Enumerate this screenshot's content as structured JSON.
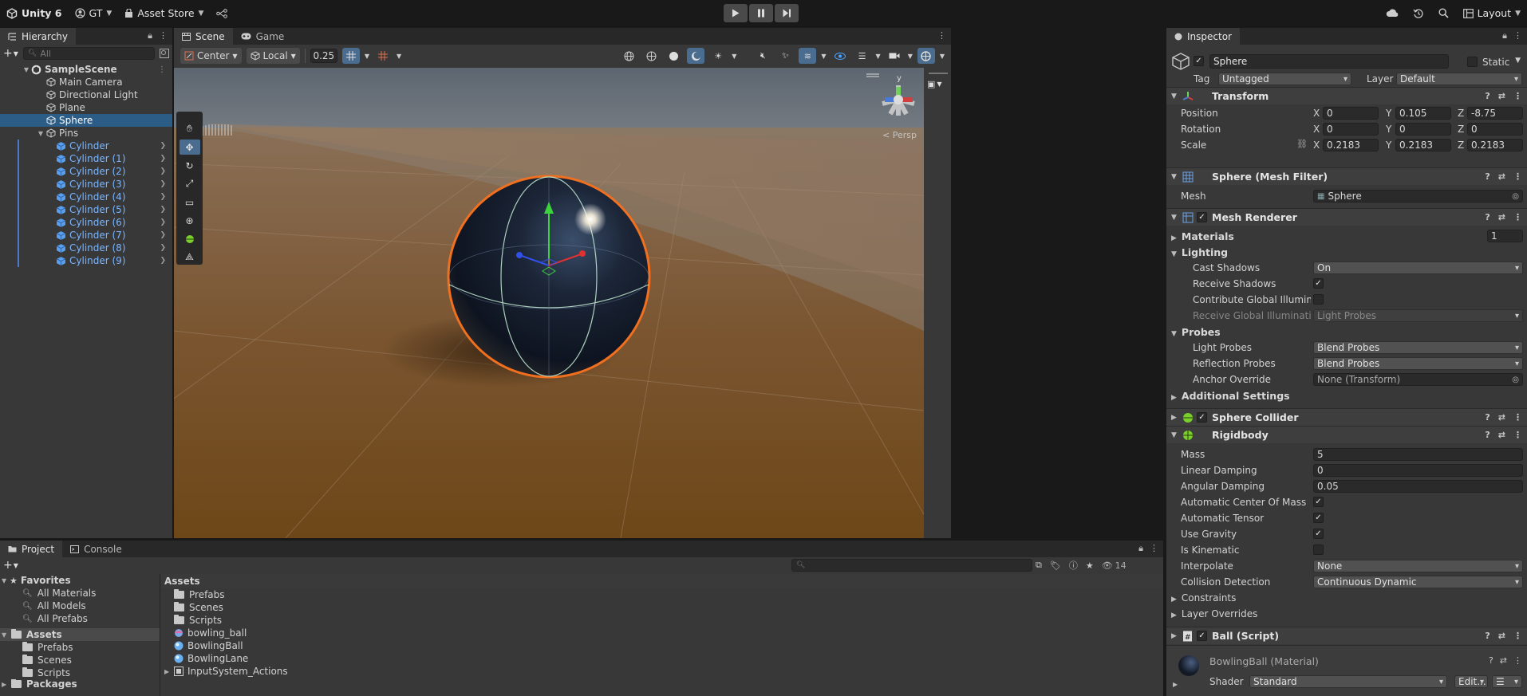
{
  "topbar": {
    "version": "Unity 6",
    "account": "GT",
    "asset_store": "Asset Store",
    "layout": "Layout"
  },
  "hierarchy": {
    "tab": "Hierarchy",
    "search_placeholder": "All",
    "scene": "SampleScene",
    "items": [
      "Main Camera",
      "Directional Light",
      "Plane",
      "Sphere",
      "Pins"
    ],
    "selected": "Sphere",
    "pins": [
      "Cylinder",
      "Cylinder (1)",
      "Cylinder (2)",
      "Cylinder (3)",
      "Cylinder (4)",
      "Cylinder (5)",
      "Cylinder (6)",
      "Cylinder (7)",
      "Cylinder (8)",
      "Cylinder (9)"
    ]
  },
  "scene_view": {
    "tabs": [
      "Scene",
      "Game"
    ],
    "pivot": "Center",
    "space": "Local",
    "snap": "0.25",
    "gizmo_label": "< Persp",
    "gizmo_axis": "y"
  },
  "inspector": {
    "tab": "Inspector",
    "object_name": "Sphere",
    "static_label": "Static",
    "tag_label": "Tag",
    "tag": "Untagged",
    "layer_label": "Layer",
    "layer": "Default",
    "transform": {
      "title": "Transform",
      "position_label": "Position",
      "rotation_label": "Rotation",
      "scale_label": "Scale",
      "position": {
        "x": "0",
        "y": "0.105",
        "z": "-8.75"
      },
      "rotation": {
        "x": "0",
        "y": "0",
        "z": "0"
      },
      "scale": {
        "x": "0.2183",
        "y": "0.2183",
        "z": "0.2183"
      }
    },
    "mesh_filter": {
      "title": "Sphere (Mesh Filter)",
      "mesh_label": "Mesh",
      "mesh": "Sphere"
    },
    "mesh_renderer": {
      "title": "Mesh Renderer",
      "materials_label": "Materials",
      "materials_count": "1",
      "lighting_label": "Lighting",
      "cast_shadows_label": "Cast Shadows",
      "cast_shadows": "On",
      "receive_shadows_label": "Receive Shadows",
      "contribute_gi_label": "Contribute Global Illuminat",
      "receive_gi_label": "Receive Global Illuminatio",
      "receive_gi": "Light Probes",
      "probes_label": "Probes",
      "light_probes_label": "Light Probes",
      "light_probes": "Blend Probes",
      "reflection_probes_label": "Reflection Probes",
      "reflection_probes": "Blend Probes",
      "anchor_override_label": "Anchor Override",
      "anchor_override": "None (Transform)",
      "additional_settings": "Additional Settings"
    },
    "sphere_collider": {
      "title": "Sphere Collider"
    },
    "rigidbody": {
      "title": "Rigidbody",
      "mass_label": "Mass",
      "mass": "5",
      "linear_damping_label": "Linear Damping",
      "linear_damping": "0",
      "angular_damping_label": "Angular Damping",
      "angular_damping": "0.05",
      "auto_com_label": "Automatic Center Of Mass",
      "auto_tensor_label": "Automatic Tensor",
      "use_gravity_label": "Use Gravity",
      "is_kinematic_label": "Is Kinematic",
      "interpolate_label": "Interpolate",
      "interpolate": "None",
      "collision_label": "Collision Detection",
      "collision": "Continuous Dynamic",
      "constraints_label": "Constraints",
      "layer_overrides_label": "Layer Overrides"
    },
    "ball_script": {
      "title": "Ball (Script)"
    },
    "material": {
      "name": "BowlingBall (Material)",
      "shader_label": "Shader",
      "shader": "Standard",
      "edit": "Edit..."
    }
  },
  "project": {
    "tabs": [
      "Project",
      "Console"
    ],
    "count": "14",
    "favorites_label": "Favorites",
    "favorites": [
      "All Materials",
      "All Models",
      "All Prefabs"
    ],
    "assets_label": "Assets",
    "asset_folders": [
      "Prefabs",
      "Scenes",
      "Scripts"
    ],
    "packages_label": "Packages",
    "breadcrumb": "Assets",
    "assets": [
      {
        "name": "Prefabs",
        "kind": "folder"
      },
      {
        "name": "Scenes",
        "kind": "folder"
      },
      {
        "name": "Scripts",
        "kind": "folder"
      },
      {
        "name": "bowling_ball",
        "kind": "model"
      },
      {
        "name": "BowlingBall",
        "kind": "material"
      },
      {
        "name": "BowlingLane",
        "kind": "material"
      },
      {
        "name": "InputSystem_Actions",
        "kind": "input-actions"
      }
    ]
  }
}
